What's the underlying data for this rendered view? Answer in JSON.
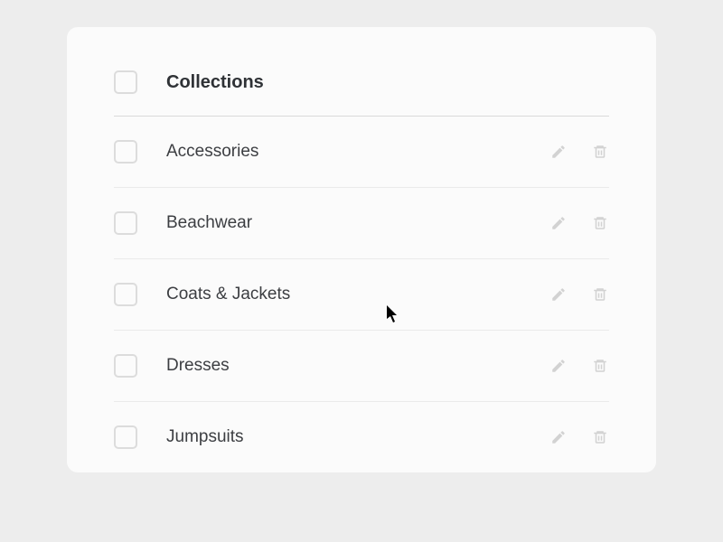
{
  "header": {
    "title": "Collections"
  },
  "items": [
    {
      "name": "Accessories"
    },
    {
      "name": "Beachwear"
    },
    {
      "name": "Coats & Jackets"
    },
    {
      "name": "Dresses"
    },
    {
      "name": "Jumpsuits"
    }
  ]
}
